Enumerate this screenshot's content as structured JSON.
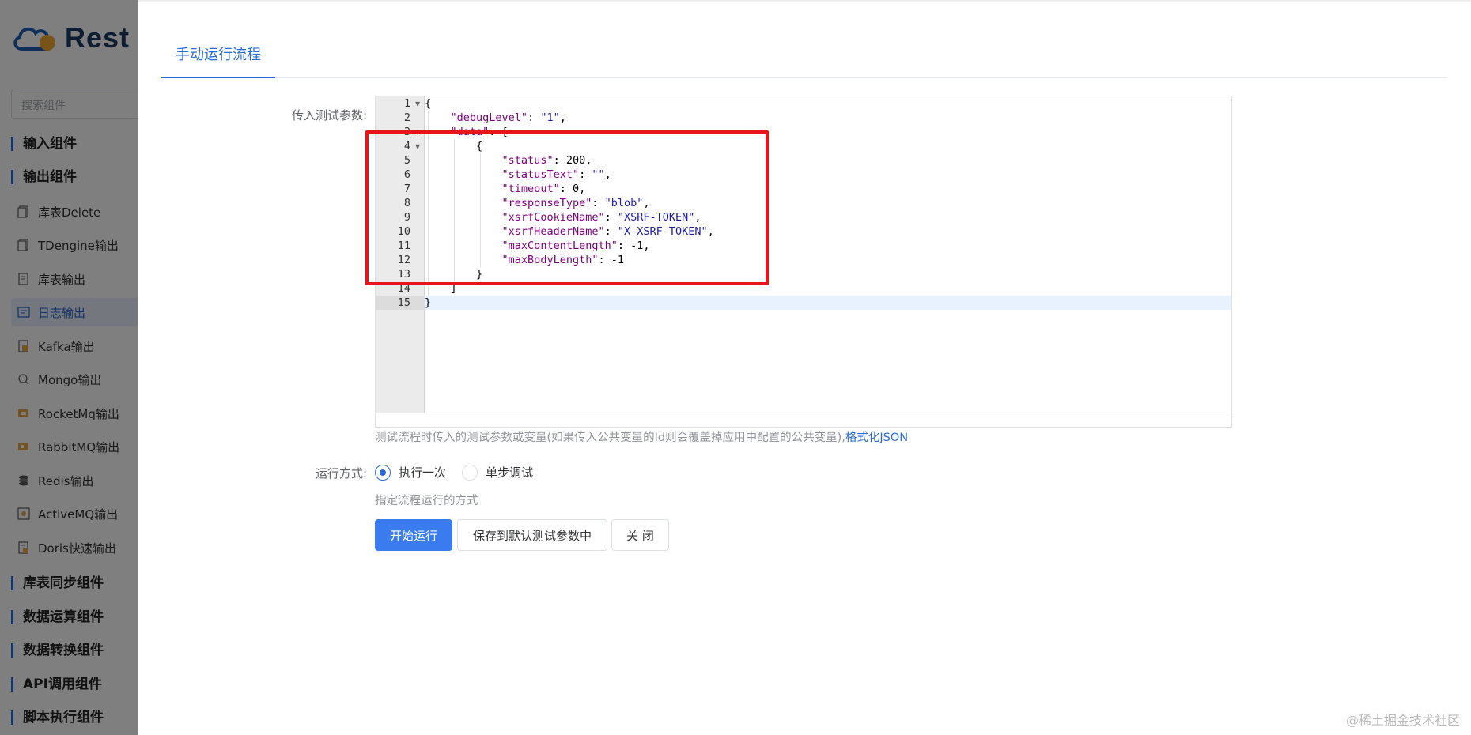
{
  "sidebar": {
    "logo_text": "Rest",
    "search_placeholder": "搜索组件",
    "groups": {
      "input": "输入组件",
      "output": "输出组件",
      "sync": "库表同步组件",
      "compute": "数据运算组件",
      "transform": "数据转换组件",
      "api": "API调用组件",
      "script": "脚本执行组件"
    },
    "items": [
      {
        "label": "库表Delete",
        "icon": "table-delete-icon"
      },
      {
        "label": "TDengine输出",
        "icon": "tdengine-icon"
      },
      {
        "label": "库表输出",
        "icon": "table-output-icon"
      },
      {
        "label": "日志输出",
        "icon": "log-output-icon"
      },
      {
        "label": "Kafka输出",
        "icon": "kafka-icon"
      },
      {
        "label": "Mongo输出",
        "icon": "mongo-icon"
      },
      {
        "label": "RocketMq输出",
        "icon": "rocketmq-icon"
      },
      {
        "label": "RabbitMQ输出",
        "icon": "rabbitmq-icon"
      },
      {
        "label": "Redis输出",
        "icon": "redis-icon"
      },
      {
        "label": "ActiveMQ输出",
        "icon": "activemq-icon"
      },
      {
        "label": "Doris快速输出",
        "icon": "doris-icon"
      }
    ],
    "active_item": "日志输出"
  },
  "drawer": {
    "tab_label": "手动运行流程",
    "params_label": "传入测试参数:",
    "editor": {
      "line_numbers": [
        "1",
        "2",
        "3",
        "4",
        "5",
        "6",
        "7",
        "8",
        "9",
        "10",
        "11",
        "12",
        "13",
        "14",
        "15"
      ],
      "lines": [
        "{",
        "    \"debugLevel\": \"1\",",
        "    \"data\": [",
        "        {",
        "            \"status\": 200,",
        "            \"statusText\": \"\",",
        "            \"timeout\": 0,",
        "            \"responseType\": \"blob\",",
        "            \"xsrfCookieName\": \"XSRF-TOKEN\",",
        "            \"xsrfHeaderName\": \"X-XSRF-TOKEN\",",
        "            \"maxContentLength\": -1,",
        "            \"maxBodyLength\": -1",
        "        }",
        "    ]",
        "}"
      ]
    },
    "params_hint": "测试流程时传入的测试参数或变量(如果传入公共变量的Id则会覆盖掉应用中配置的公共变量),",
    "format_link": "格式化JSON",
    "run_mode_label": "运行方式:",
    "run_modes": [
      {
        "label": "执行一次",
        "selected": true
      },
      {
        "label": "单步调试",
        "selected": false
      }
    ],
    "run_mode_hint": "指定流程运行的方式",
    "buttons": {
      "start": "开始运行",
      "save": "保存到默认测试参数中",
      "close": "关 闭"
    }
  },
  "watermark": "@稀土掘金技术社区",
  "colors": {
    "accent": "#2b6bd6",
    "primary_button": "#3a7bf0",
    "highlight_box": "#e8141b"
  }
}
